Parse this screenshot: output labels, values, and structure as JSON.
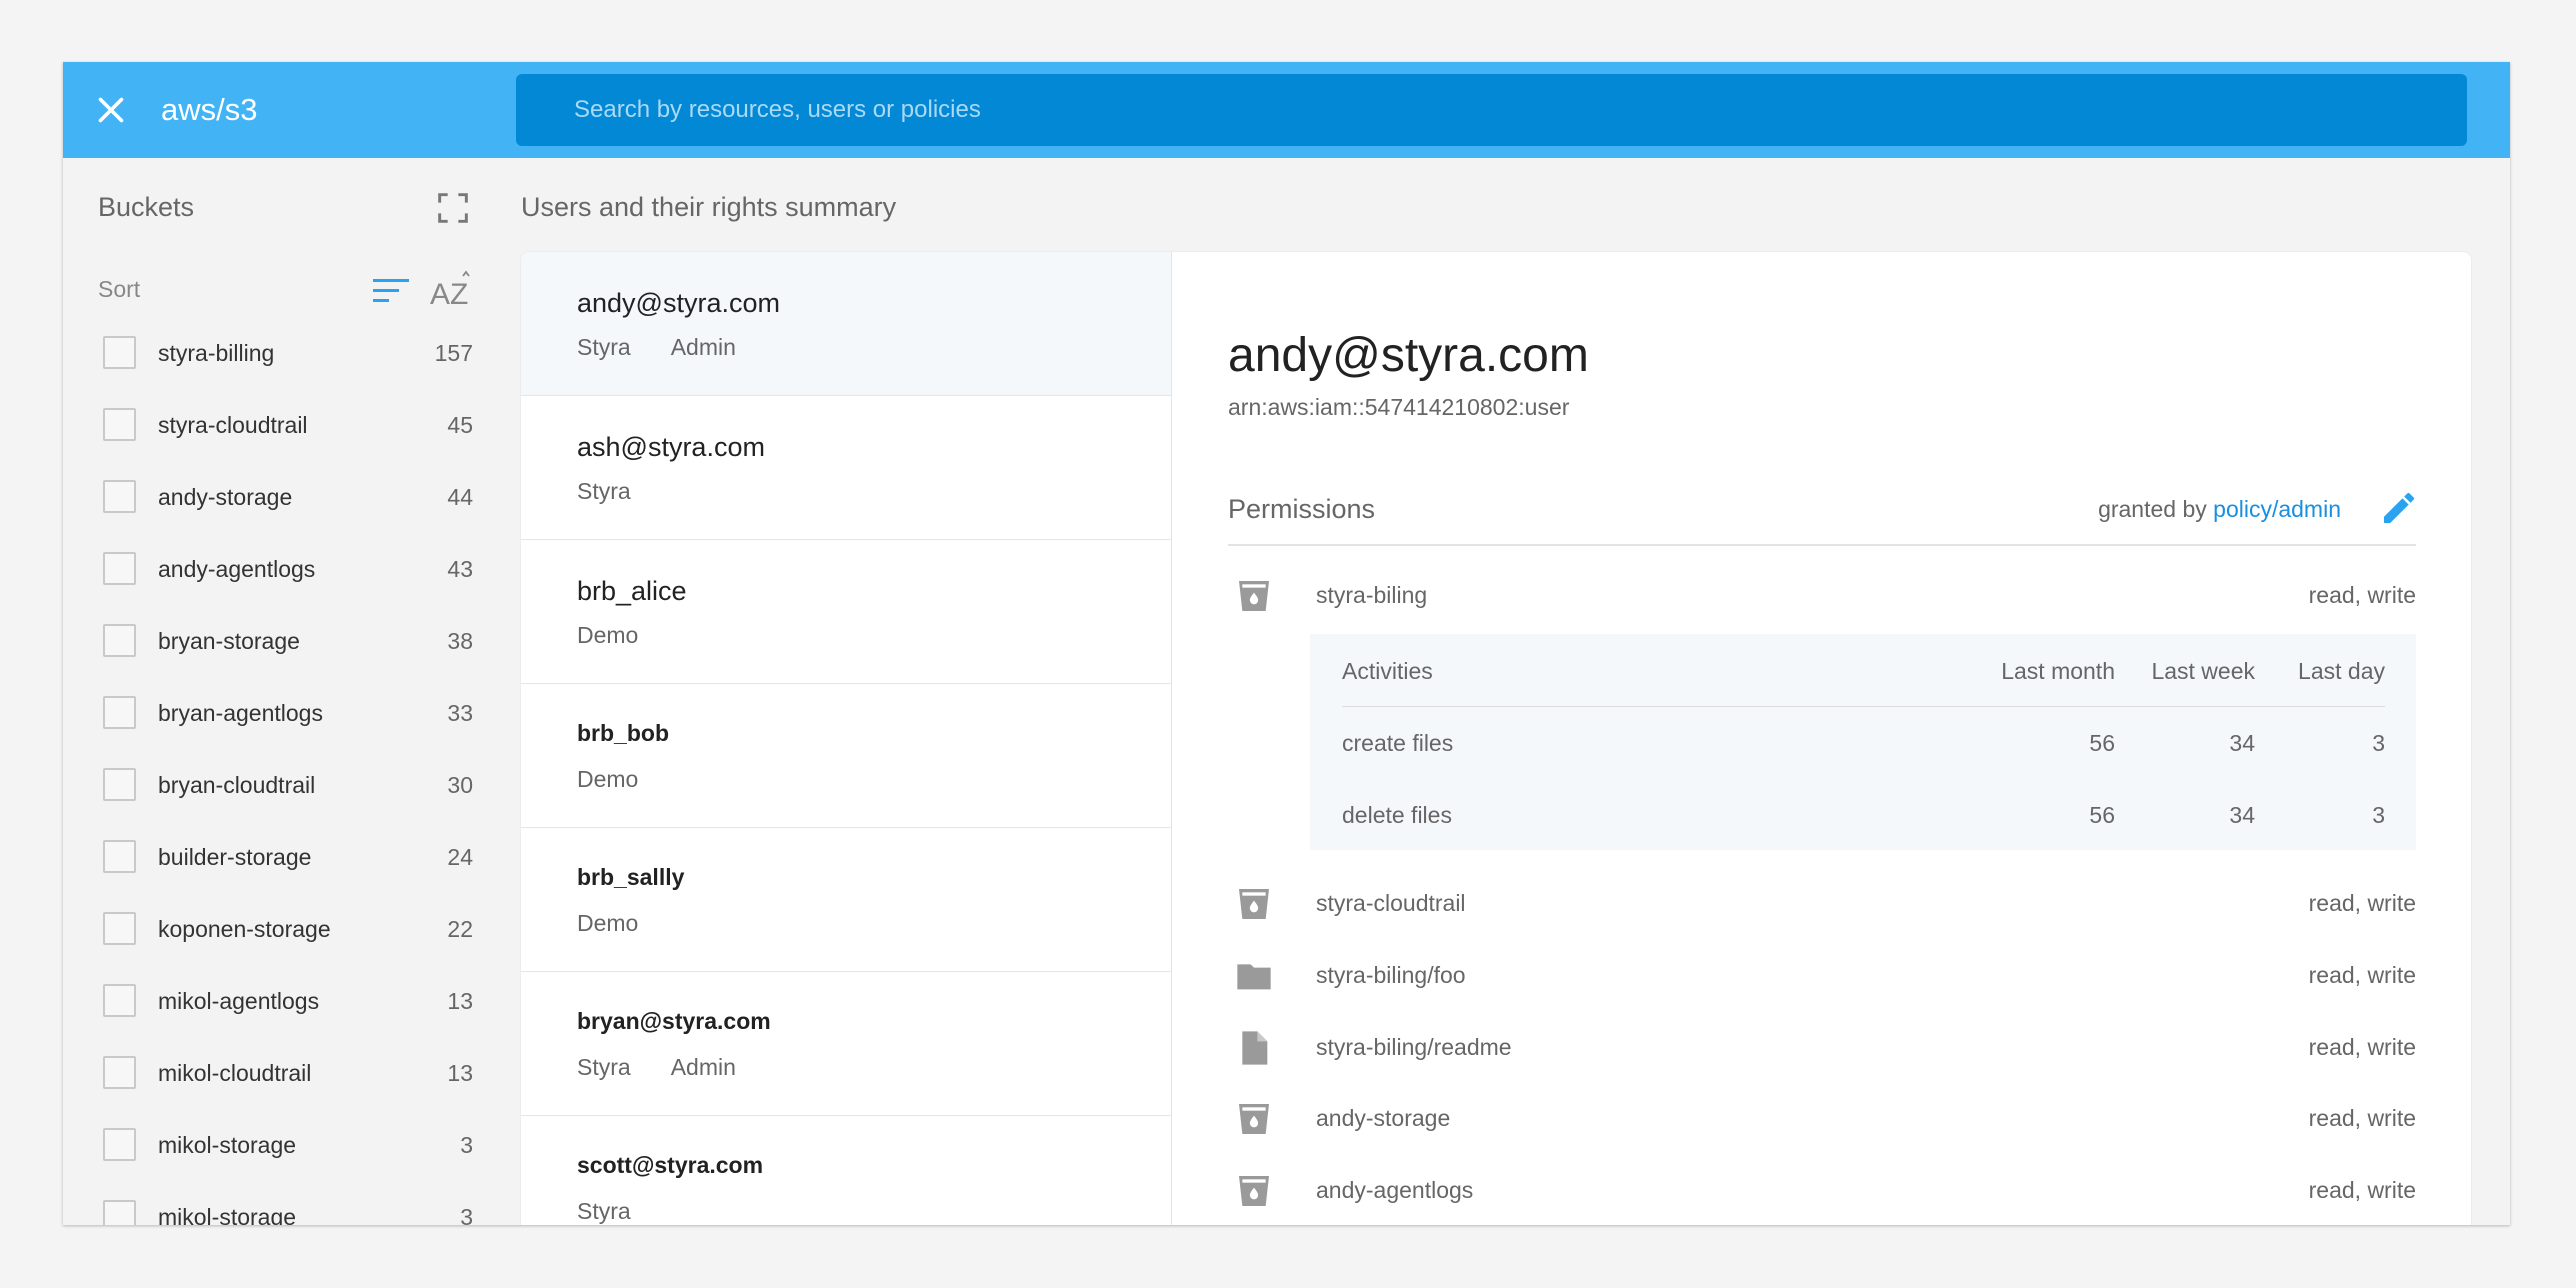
{
  "app": {
    "title": "aws/s3"
  },
  "search": {
    "placeholder": "Search by resources, users or policies"
  },
  "sidebar": {
    "title": "Buckets",
    "sort_label": "Sort",
    "buckets": [
      {
        "name": "styra-billing",
        "count": "157"
      },
      {
        "name": "styra-cloudtrail",
        "count": "45"
      },
      {
        "name": "andy-storage",
        "count": "44"
      },
      {
        "name": "andy-agentlogs",
        "count": "43"
      },
      {
        "name": "bryan-storage",
        "count": "38"
      },
      {
        "name": "bryan-agentlogs",
        "count": "33"
      },
      {
        "name": "bryan-cloudtrail",
        "count": "30"
      },
      {
        "name": "builder-storage",
        "count": "24"
      },
      {
        "name": "koponen-storage",
        "count": "22"
      },
      {
        "name": "mikol-agentlogs",
        "count": "13"
      },
      {
        "name": "mikol-cloudtrail",
        "count": "13"
      },
      {
        "name": "mikol-storage",
        "count": "3"
      },
      {
        "name": "mikol-storage",
        "count": "3"
      }
    ]
  },
  "main": {
    "title": "Users and their rights summary"
  },
  "users": [
    {
      "name": "andy@styra.com",
      "org": "Styra",
      "role": "Admin"
    },
    {
      "name": "ash@styra.com",
      "org": "Styra",
      "role": ""
    },
    {
      "name": "brb_alice",
      "org": "Demo",
      "role": ""
    },
    {
      "name": "brb_bob",
      "org": "Demo",
      "role": ""
    },
    {
      "name": "brb_sallly",
      "org": "Demo",
      "role": ""
    },
    {
      "name": "bryan@styra.com",
      "org": "Styra",
      "role": "Admin"
    },
    {
      "name": "scott@styra.com",
      "org": "Styra",
      "role": ""
    }
  ],
  "detail": {
    "name": "andy@styra.com",
    "arn": "arn:aws:iam::547414210802:user",
    "permissions_title": "Permissions",
    "granted_prefix": "granted by",
    "granted_link": "policy/admin",
    "resources": [
      {
        "name": "styra-biling",
        "rights": "read, write",
        "icon": "bucket-icon"
      },
      {
        "name": "styra-cloudtrail",
        "rights": "read, write",
        "icon": "bucket-icon"
      },
      {
        "name": "styra-biling/foo",
        "rights": "read, write",
        "icon": "folder-icon"
      },
      {
        "name": "styra-biling/readme",
        "rights": "read, write",
        "icon": "file-icon"
      },
      {
        "name": "andy-storage",
        "rights": "read, write",
        "icon": "bucket-icon"
      },
      {
        "name": "andy-agentlogs",
        "rights": "read, write",
        "icon": "bucket-icon"
      }
    ],
    "activities": {
      "headers": [
        "Activities",
        "Last month",
        "Last week",
        "Last day"
      ],
      "rows": [
        {
          "activity": "create files",
          "month": "56",
          "week": "34",
          "day": "3"
        },
        {
          "activity": "delete files",
          "month": "56",
          "week": "34",
          "day": "3"
        }
      ]
    }
  },
  "colors": {
    "topbar": "#42b4f5",
    "search": "#0288d5",
    "accent": "#29a3ef"
  }
}
